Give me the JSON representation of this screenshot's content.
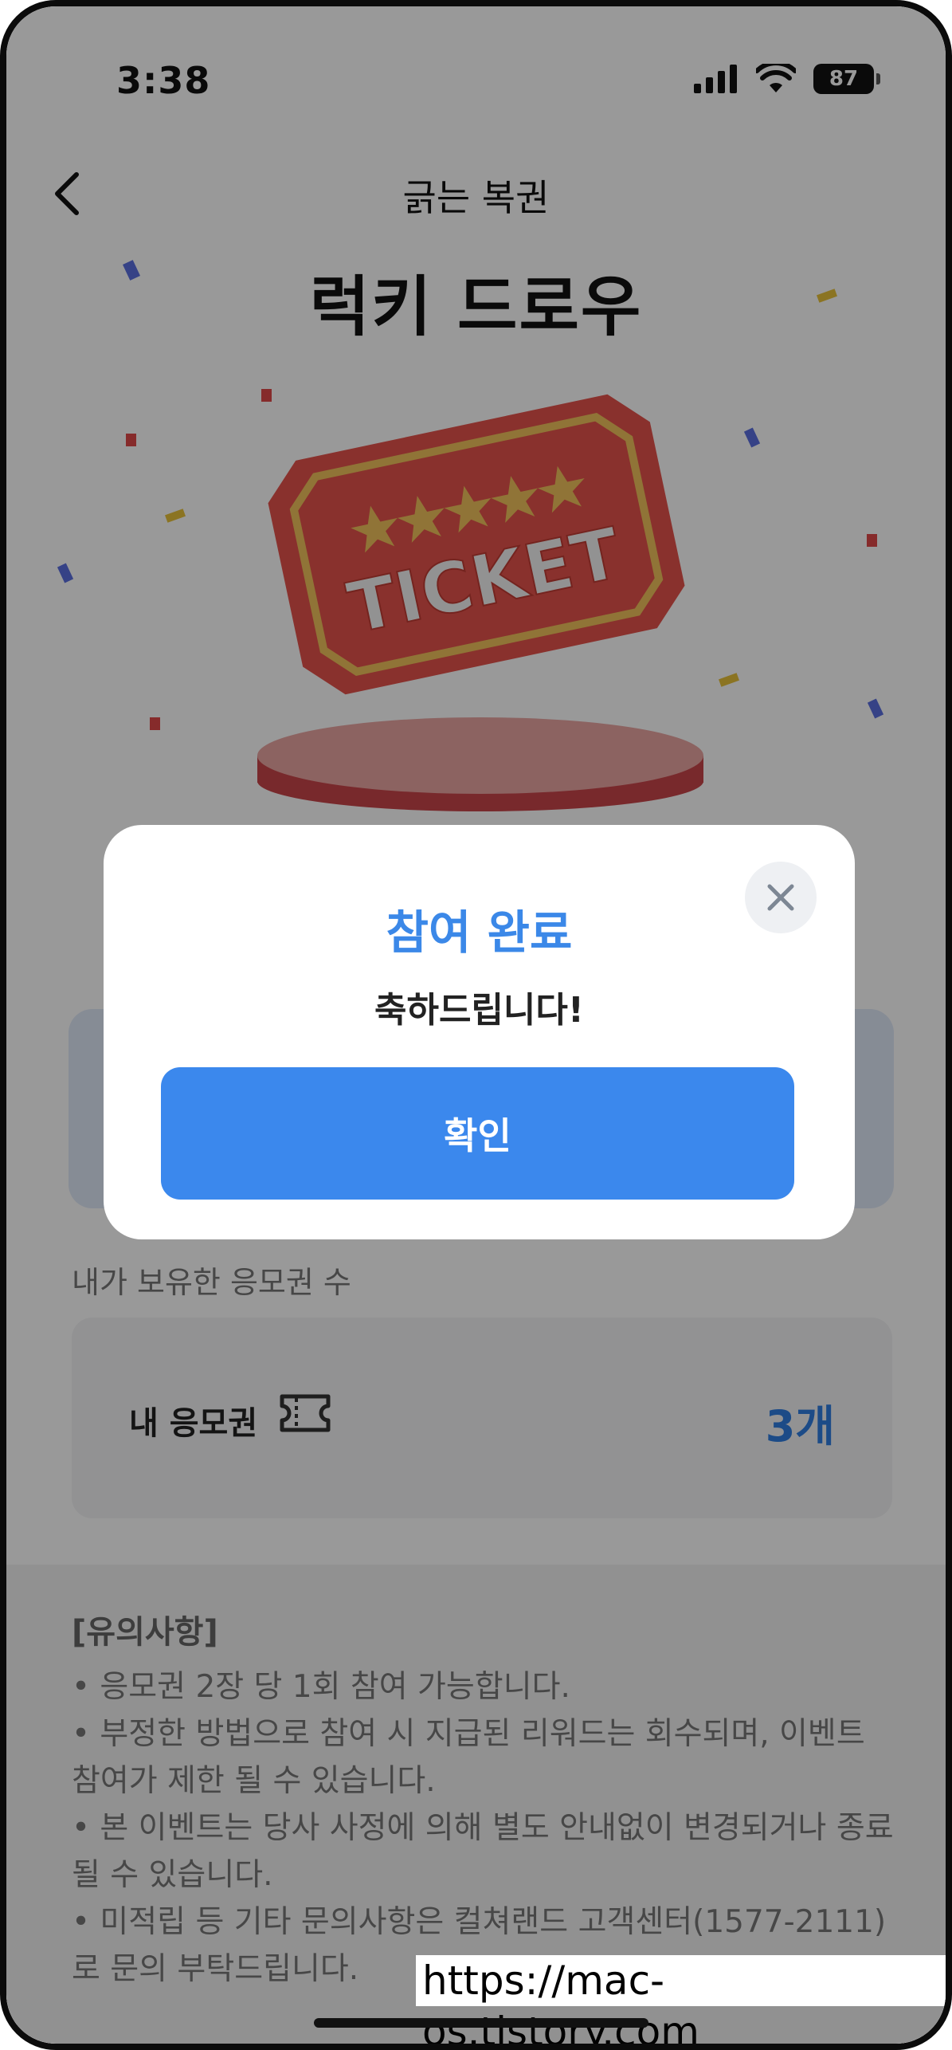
{
  "status_bar": {
    "time": "3:38",
    "battery": "87"
  },
  "header": {
    "title": "긁는 복권"
  },
  "hero": {
    "title": "럭키 드로우",
    "ticket_text": "TICKET"
  },
  "owned": {
    "caption": "내가 보유한 응모권 수",
    "label": "내 응모권",
    "count": "3개"
  },
  "notes": {
    "title": "[유의사항]",
    "items": [
      "• 응모권 2장 당 1회 참여 가능합니다.",
      "• 부정한 방법으로 참여 시 지급된 리워드는 회수되며, 이벤트 참여가 제한 될 수 있습니다.",
      "• 본 이벤트는 당사 사정에 의해 별도 안내없이 변경되거나 종료 될 수 있습니다.",
      "• 미적립 등 기타 문의사항은 컬쳐랜드 고객센터(1577-2111)로 문의 부탁드립니다."
    ]
  },
  "modal": {
    "title": "참여 완료",
    "message": "축하드립니다!",
    "confirm_label": "확인"
  },
  "watermark": "https://mac-os.tistory.com",
  "colors": {
    "accent": "#3b88ed",
    "count": "#2f7de1",
    "ticket_red": "#e5534b"
  }
}
